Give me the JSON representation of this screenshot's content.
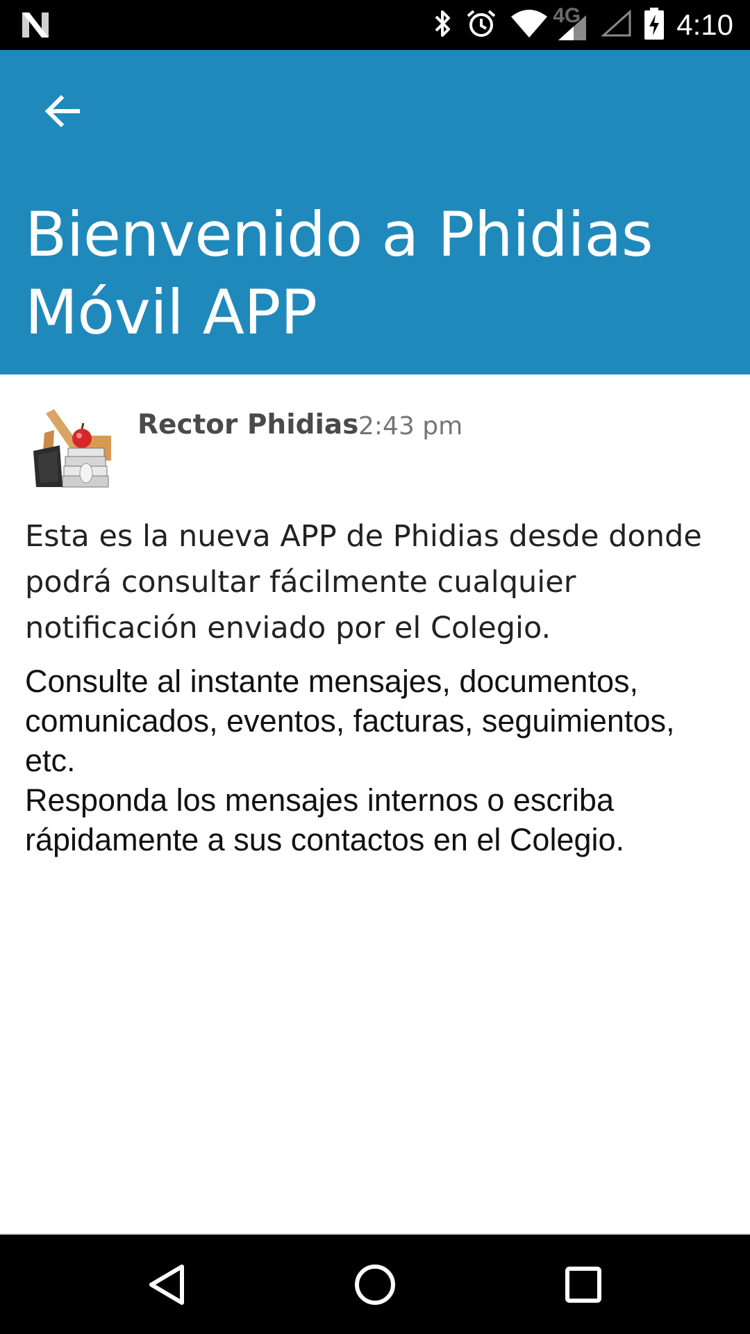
{
  "status_bar": {
    "time": "4:10",
    "network_label": "4G",
    "icons": [
      "n-logo-icon",
      "bluetooth-icon",
      "alarm-icon",
      "wifi-icon",
      "signal-icon",
      "signal-empty-icon",
      "battery-charging-icon"
    ]
  },
  "header": {
    "title": "Bienvenido a Phidias Móvil APP",
    "back_icon": "arrow-back-icon",
    "background": "#2089bb"
  },
  "message": {
    "sender": "Rector Phidias",
    "time": "2:43 pm",
    "lead": "Esta es la nueva APP de Phidias desde donde podrá consultar fácilmente cualquier notificación enviado por el Colegio.",
    "paragraph_1": "Consulte al instante mensajes, documentos, comunicados, eventos, facturas, seguimientos, etc.",
    "paragraph_2": "Responda los mensajes internos o escriba rápidamente a sus contactos en el Colegio."
  },
  "nav_bar": {
    "buttons": [
      "back-triangle-icon",
      "home-circle-icon",
      "recents-square-icon"
    ]
  }
}
